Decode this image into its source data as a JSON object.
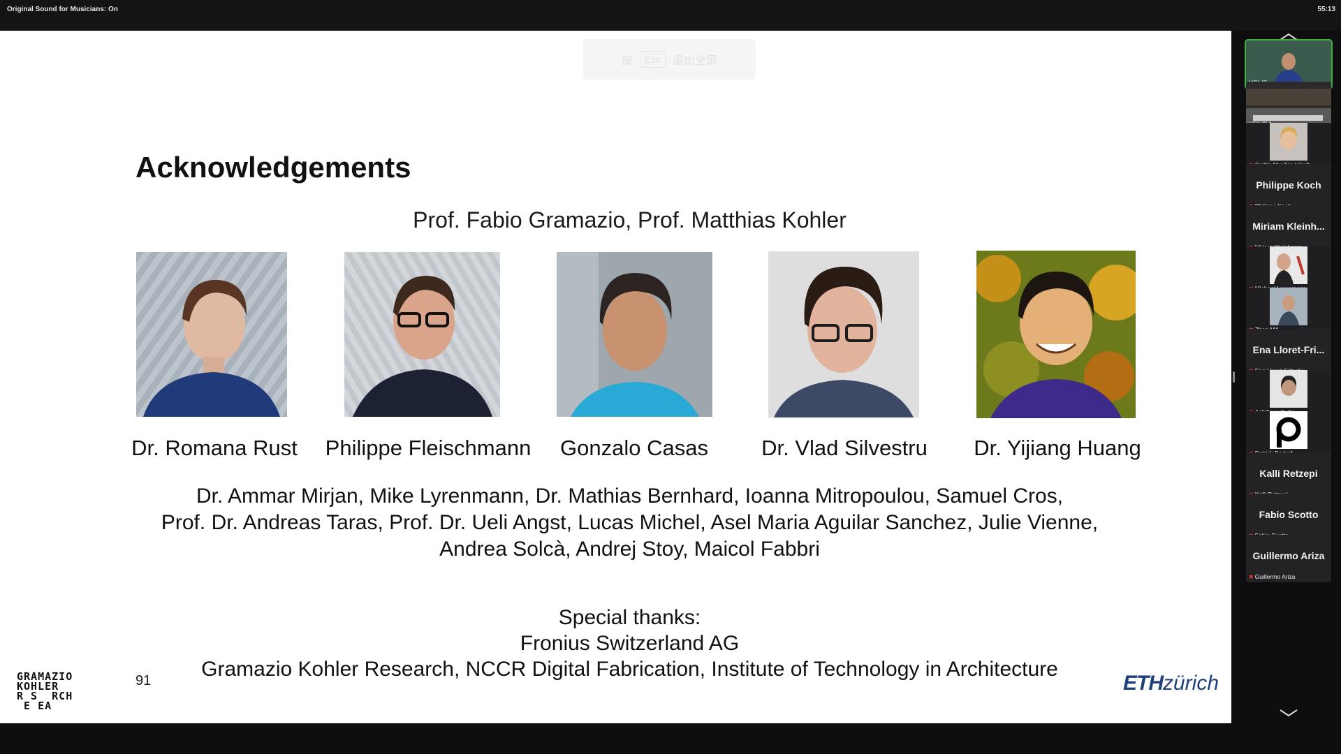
{
  "top_bar": {
    "status": "Original Sound for Musicians: On",
    "timer": "55:13"
  },
  "esc_hint": {
    "prefix": "按",
    "key": "Esc",
    "suffix": "退出全屏"
  },
  "slide": {
    "title": "Acknowledgements",
    "professors": "Prof. Fabio Gramazio, Prof. Matthias Kohler",
    "people": [
      {
        "name": "Dr. Romana Rust"
      },
      {
        "name": "Philippe Fleischmann"
      },
      {
        "name": "Gonzalo Casas"
      },
      {
        "name": "Dr. Vlad Silvestru"
      },
      {
        "name": "Dr. Yijiang Huang"
      }
    ],
    "others": [
      "Dr. Ammar Mirjan, Mike Lyrenmann, Dr. Mathias Bernhard, Ioanna Mitropoulou, Samuel Cros,",
      "Prof. Dr. Andreas Taras, Prof. Dr. Ueli Angst, Lucas Michel, Asel Maria Aguilar Sanchez, Julie Vienne,",
      "Andrea Solcà, Andrej Stoy, Maicol Fabbri"
    ],
    "special": [
      "Special thanks:",
      "Fronius Switzerland AG",
      "Gramazio Kohler Research, NCCR Digital Fabrication, Institute of Technology in Architecture"
    ],
    "page_number": "91",
    "logo_gkr": [
      "GRAMAZIO",
      "KOHLER",
      "R S  RCH",
      " E EA"
    ],
    "logo_eth": {
      "bold": "ETH",
      "italic": "zürich"
    }
  },
  "participants": [
    {
      "tile_label": "HCI J2",
      "has_video": true,
      "active": true
    },
    {
      "tile_label": "HCI J2 1",
      "has_video": true
    },
    {
      "tile_label": "Caitlin Mueller (she/h...",
      "has_video": true
    },
    {
      "display_name": "Philippe Koch",
      "tile_label": "Philippe Koch",
      "has_video": false
    },
    {
      "display_name": "Miriam Kleinh...",
      "tile_label": "Miriam Kleinhenz",
      "has_video": false
    },
    {
      "tile_label": "Michael Lyrenmann",
      "has_video": true
    },
    {
      "tile_label": "Zhao MA",
      "has_video": true
    },
    {
      "display_name": "Ena Lloret-Fri...",
      "tile_label": "Ena Lloret-Fritschi",
      "has_video": false
    },
    {
      "tile_label": "Achilleas Xydis",
      "has_video": true
    },
    {
      "tile_label": "Patrick Bedarf",
      "has_video": true
    },
    {
      "display_name": "Kalli Retzepi",
      "tile_label": "Kalli Retzepi",
      "has_video": false
    },
    {
      "display_name": "Fabio Scotto",
      "tile_label": "Fabio Scotto",
      "has_video": false
    },
    {
      "display_name": "Guillermo Ariza",
      "tile_label": "Guillermo Ariza",
      "has_video": false
    }
  ]
}
